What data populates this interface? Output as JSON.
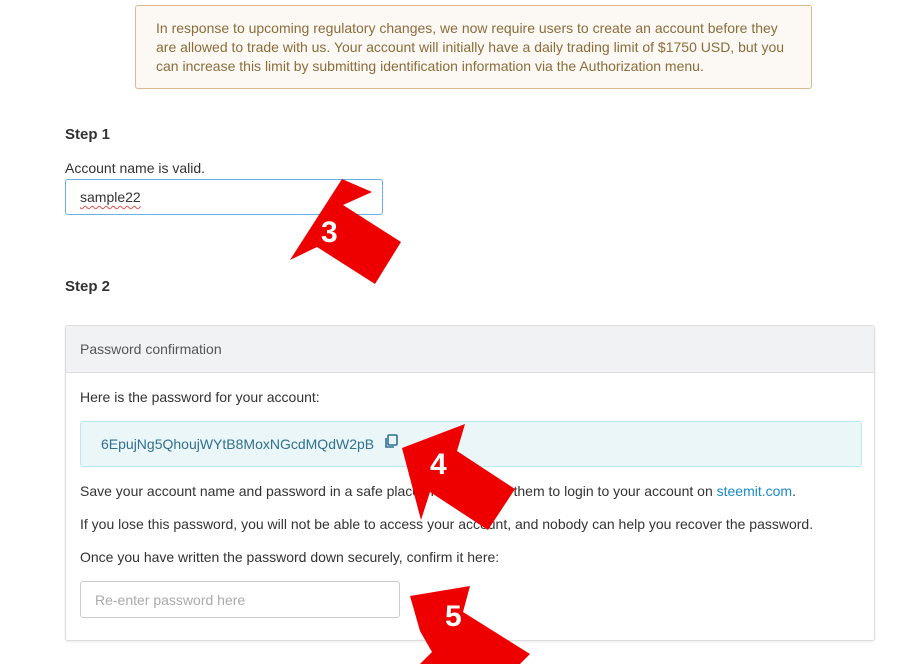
{
  "notice": {
    "text": "In response to upcoming regulatory changes, we now require users to create an account before they are allowed to trade with us. Your account will initially have a daily trading limit of $1750 USD, but you can increase this limit by submitting identification information via the Authorization menu."
  },
  "step1": {
    "title": "Step 1",
    "validation": "Account name is valid.",
    "account_name_value": "sample22"
  },
  "step2": {
    "title": "Step 2",
    "panel": {
      "heading": "Password confirmation",
      "intro": "Here is the password for your account:",
      "password": "6EpujNg5QhoujWYtB8MoxNGcdMQdW2pB",
      "save_text_before": "Save your account name and password in a safe place. You will need them to login to your account on ",
      "save_link": "steemit.com",
      "save_text_after": ".",
      "lose_text": "If you lose this password, you will not be able to access your account, and nobody can help you recover the password.",
      "confirm_text": "Once you have written the password down securely, confirm it here:",
      "confirm_placeholder": "Re-enter password here"
    }
  },
  "annotations": {
    "color": "#ee0000",
    "arrow_3_label": "3",
    "arrow_4_label": "4",
    "arrow_5_label": "5"
  },
  "icons": {
    "copy": "copy-icon"
  },
  "colors": {
    "notice_bg": "#fcf8f3",
    "notice_border": "#dcb98a",
    "notice_text": "#8a6d3b",
    "password_box_bg": "#eaf6f8",
    "password_text": "#31708f",
    "link": "#1a8bc6",
    "input_focus_border": "#66afe9"
  }
}
